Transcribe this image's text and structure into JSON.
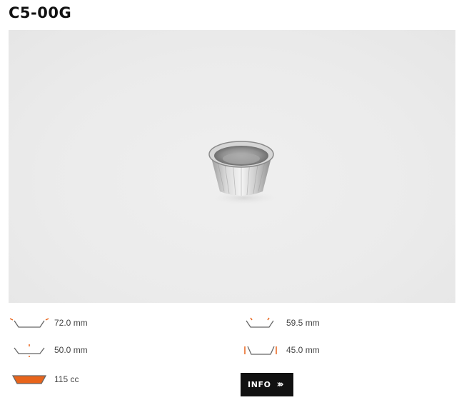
{
  "product": {
    "code": "C5-00G"
  },
  "specs": {
    "top_width": {
      "icon": "top-diameter-icon",
      "value": "72.0 mm"
    },
    "top_length": {
      "icon": "top-length-icon",
      "value": "59.5 mm"
    },
    "bottom_width": {
      "icon": "bottom-diameter-icon",
      "value": "50.0 mm"
    },
    "height": {
      "icon": "height-icon",
      "value": "45.0 mm"
    },
    "capacity": {
      "icon": "capacity-icon",
      "value": "115 cc"
    }
  },
  "actions": {
    "info_label": "INFO",
    "info_chevron": "›››"
  },
  "colors": {
    "accent": "#e8641b",
    "button_bg": "#111111",
    "photo_bg": "#ebebeb"
  }
}
